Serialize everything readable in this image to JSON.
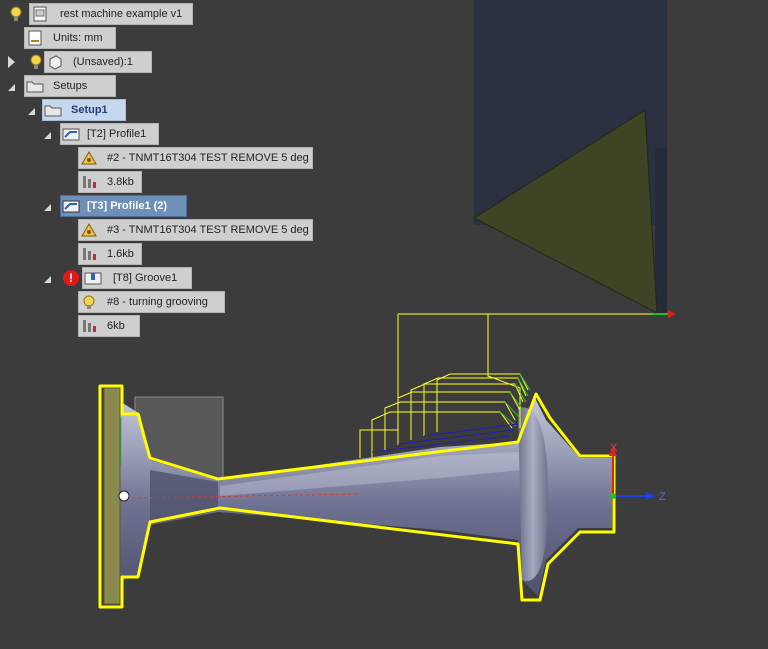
{
  "tree": {
    "root_label": "rest machine example v1",
    "units_label": "Units: mm",
    "model_label": "(Unsaved):1",
    "setups_label": "Setups",
    "setup1_label": "Setup1",
    "op1": {
      "label": "[T2] Profile1",
      "tool": "#2 - TNMT16T304 TEST REMOVE 5 deg",
      "size": "3.8kb"
    },
    "op2": {
      "label": "[T3] Profile1 (2)",
      "tool": "#3 - TNMT16T304 TEST REMOVE 5 deg",
      "size": "1.6kb"
    },
    "op3": {
      "label": "[T8] Groove1",
      "tool": "#8 - turning grooving",
      "size": "6kb",
      "status": "!"
    }
  },
  "triad": {
    "x_label": "X",
    "z_label": "Z"
  },
  "colors": {
    "background": "#3c3c3c",
    "toolpath": "#ffff00",
    "part": "#8a8ea6",
    "axis_x": "#e02020",
    "axis_z": "#2040e0",
    "axis_y": "#20c020"
  }
}
